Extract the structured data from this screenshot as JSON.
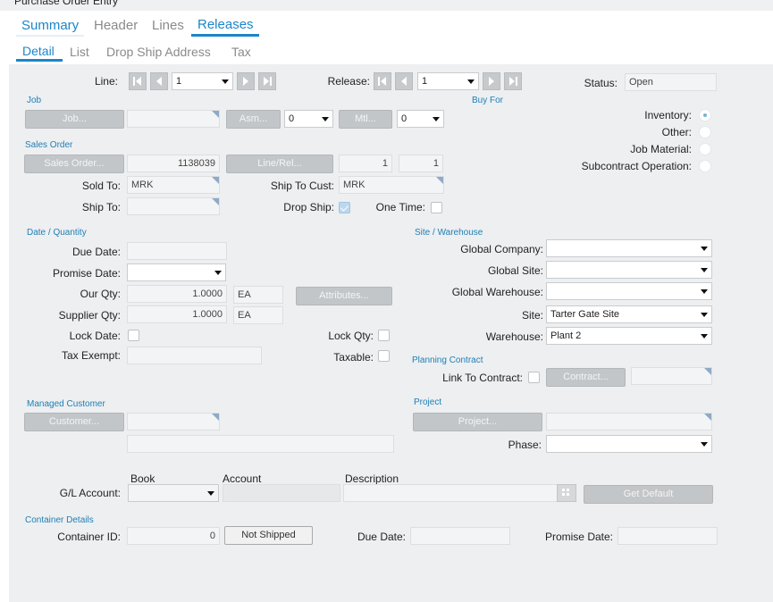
{
  "window": {
    "title": "Purchase Order Entry"
  },
  "tabs_primary": [
    "Summary",
    "Header",
    "Lines",
    "Releases"
  ],
  "tabs_secondary": [
    "Detail",
    "List",
    "Drop Ship Address",
    "Tax"
  ],
  "top": {
    "line_label": "Line:",
    "line_value": "1",
    "release_label": "Release:",
    "release_value": "1",
    "status_label": "Status:",
    "status_value": "Open"
  },
  "job": {
    "section": "Job",
    "job_button": "Job...",
    "job_value": "",
    "asm_button": "Asm...",
    "asm_value": "0",
    "mtl_button": "Mtl...",
    "mtl_value": "0"
  },
  "buy_for": {
    "section": "Buy For",
    "options": [
      "Inventory:",
      "Other:",
      "Job Material:",
      "Subcontract Operation:"
    ],
    "selected": "Inventory:"
  },
  "sales_order": {
    "section": "Sales Order",
    "so_button": "Sales Order...",
    "so_value": "1138039",
    "linerel_button": "Line/Rel...",
    "line_value": "1",
    "rel_value": "1",
    "sold_to_label": "Sold To:",
    "sold_to_value": "MRK",
    "ship_to_cust_label": "Ship To Cust:",
    "ship_to_cust_value": "MRK",
    "ship_to_label": "Ship To:",
    "ship_to_value": "",
    "drop_ship_label": "Drop Ship:",
    "drop_ship_checked": true,
    "one_time_label": "One Time:",
    "one_time_checked": false
  },
  "date_qty": {
    "section": "Date / Quantity",
    "due_date_label": "Due Date:",
    "due_date_value": "",
    "promise_date_label": "Promise Date:",
    "promise_date_value": "",
    "our_qty_label": "Our Qty:",
    "our_qty_value": "1.0000",
    "our_uom": "EA",
    "supplier_qty_label": "Supplier Qty:",
    "supplier_qty_value": "1.0000",
    "supplier_uom": "EA",
    "attributes_button": "Attributes...",
    "lock_date_label": "Lock Date:",
    "lock_qty_label": "Lock Qty:",
    "tax_exempt_label": "Tax Exempt:",
    "tax_exempt_value": "",
    "taxable_label": "Taxable:"
  },
  "site_wh": {
    "section": "Site / Warehouse",
    "global_company_label": "Global Company:",
    "global_company_value": "",
    "global_site_label": "Global Site:",
    "global_site_value": "",
    "global_warehouse_label": "Global Warehouse:",
    "global_warehouse_value": "",
    "site_label": "Site:",
    "site_value": "Tarter Gate Site",
    "warehouse_label": "Warehouse:",
    "warehouse_value": "Plant 2"
  },
  "planning": {
    "section": "Planning Contract",
    "link_label": "Link To Contract:",
    "contract_button": "Contract...",
    "contract_value": ""
  },
  "managed_customer": {
    "section": "Managed Customer",
    "button": "Customer...",
    "value": "",
    "name_value": ""
  },
  "project": {
    "section": "Project",
    "button": "Project...",
    "value": "",
    "phase_label": "Phase:",
    "phase_value": ""
  },
  "gl": {
    "book_header": "Book",
    "account_header": "Account",
    "description_header": "Description",
    "label": "G/L Account:",
    "book_value": "",
    "account_value": "",
    "description_value": "",
    "get_default_button": "Get Default"
  },
  "container": {
    "section": "Container Details",
    "id_label": "Container ID:",
    "id_value": "0",
    "status_button": "Not Shipped",
    "due_date_label": "Due Date:",
    "due_date_value": "",
    "promise_date_label": "Promise Date:",
    "promise_date_value": ""
  },
  "colors": {
    "accent": "#1b86c8",
    "section": "#1f7fb5",
    "panel": "#edeff1",
    "button": "#c3c6c9"
  }
}
